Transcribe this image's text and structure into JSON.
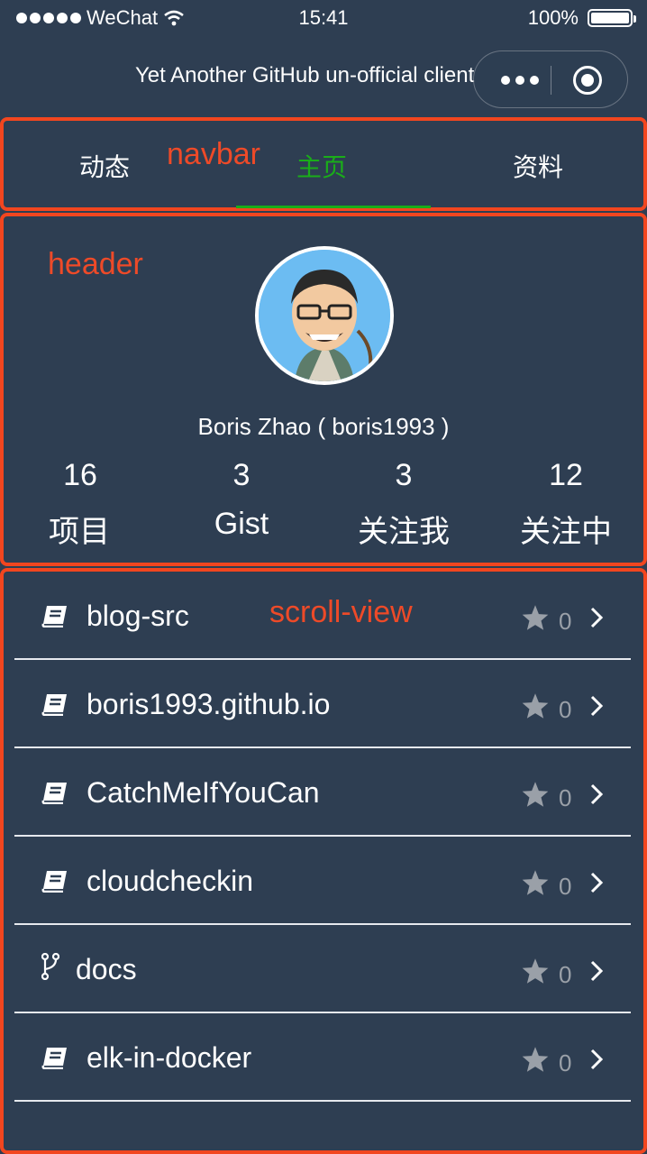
{
  "status_bar": {
    "carrier": "WeChat",
    "time": "15:41",
    "battery": "100%",
    "battery_level": 1.0
  },
  "title_bar": {
    "title": "Yet Another GitHub un-official client",
    "capsule_icons": [
      "more-icon",
      "target-icon"
    ]
  },
  "annotations": {
    "navbar": "navbar",
    "header": "header",
    "scroll_view": "scroll-view"
  },
  "navbar": {
    "tabs": [
      {
        "label": "动态",
        "active": false
      },
      {
        "label": "主页",
        "active": true
      },
      {
        "label": "资料",
        "active": false
      }
    ]
  },
  "header": {
    "name_line": "Boris Zhao ( boris1993 )",
    "stats": [
      {
        "value": "16",
        "label": "项目"
      },
      {
        "value": "3",
        "label": "Gist"
      },
      {
        "value": "3",
        "label": "关注我"
      },
      {
        "value": "12",
        "label": "关注中"
      }
    ]
  },
  "repos": [
    {
      "name": "blog-src",
      "icon": "book-icon",
      "stars": "0"
    },
    {
      "name": "boris1993.github.io",
      "icon": "book-icon",
      "stars": "0"
    },
    {
      "name": "CatchMeIfYouCan",
      "icon": "book-icon",
      "stars": "0"
    },
    {
      "name": "cloudcheckin",
      "icon": "book-icon",
      "stars": "0"
    },
    {
      "name": "docs",
      "icon": "fork-icon",
      "stars": "0"
    },
    {
      "name": "elk-in-docker",
      "icon": "book-icon",
      "stars": "0"
    }
  ],
  "colors": {
    "background": "#2e3e52",
    "accent_green": "#1aad19",
    "annotation_red": "#f2461f",
    "star_gray": "#9aa0a8"
  }
}
